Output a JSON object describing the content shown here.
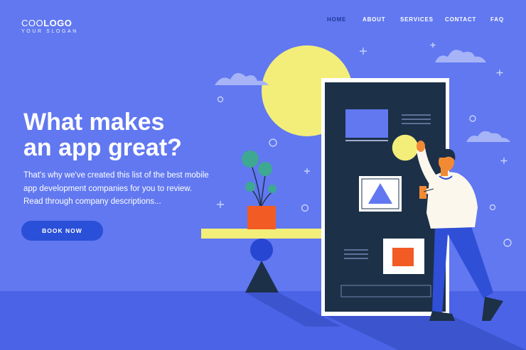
{
  "logo": {
    "main_bold": "LOGO",
    "main_thin": "COO",
    "slogan": "YOUR SLOGAN"
  },
  "nav": {
    "items": [
      {
        "label": "HOME",
        "active": true
      },
      {
        "label": "ABOUT",
        "active": false
      },
      {
        "label": "SERVICES",
        "active": false
      },
      {
        "label": "CONTACT",
        "active": false
      },
      {
        "label": "FAQ",
        "active": false
      }
    ]
  },
  "hero": {
    "title": "What makes\nan app great?",
    "description": "That's why we've created this list of the best mobile\napp development companies for you to review.\nRead through company descriptions...",
    "button_label": "BOOK NOW"
  },
  "colors": {
    "background": "#6178f0",
    "floor": "#4b63e6",
    "phone": "#1c3048",
    "sun": "#f3ee7a",
    "button": "#2a4fd8",
    "pot": "#f25b24",
    "active_nav": "#1e3a9a"
  }
}
